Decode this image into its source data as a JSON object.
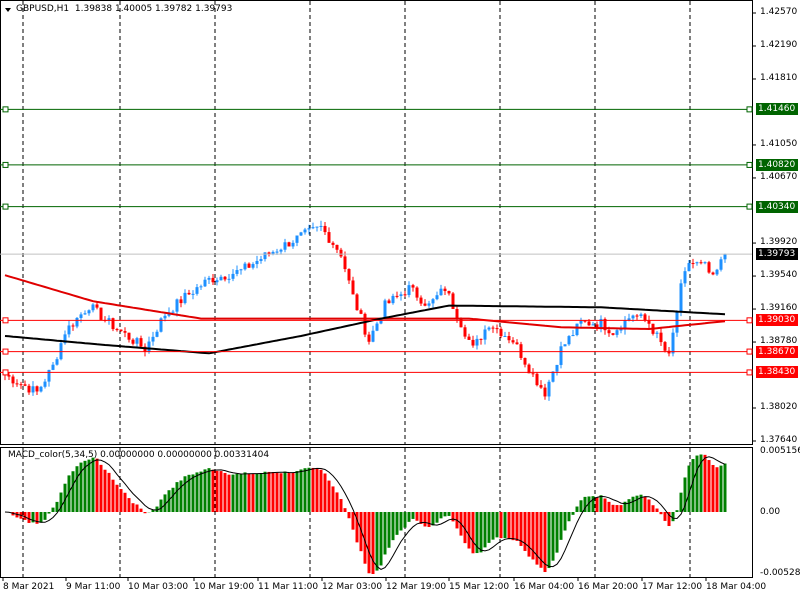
{
  "header": {
    "symbol": "GBPUSD,H1",
    "open": "1.39838",
    "high": "1.40005",
    "low": "1.39782",
    "close": "1.39793"
  },
  "price_axis": [
    "1.42570",
    "1.42190",
    "1.41810",
    "1.41050",
    "1.40670",
    "1.39920",
    "1.39540",
    "1.39160",
    "1.38780",
    "1.38020",
    "1.37640"
  ],
  "levels": [
    {
      "price": "1.41460",
      "color": "#006400"
    },
    {
      "price": "1.40820",
      "color": "#006400"
    },
    {
      "price": "1.40340",
      "color": "#006400"
    },
    {
      "price": "1.39030",
      "color": "#ff0000"
    },
    {
      "price": "1.38670",
      "color": "#ff0000"
    },
    {
      "price": "1.38430",
      "color": "#ff0000"
    }
  ],
  "current_price": "1.39793",
  "macd": {
    "label": "MACD_color(5,34,5) 0.00000000 0.00000000 0.00331404",
    "max": "0.0051569",
    "zero": "0.00",
    "min": "-0.005284"
  },
  "time_axis": [
    "8 Mar 2021",
    "9 Mar 11:00",
    "10 Mar 03:00",
    "10 Mar 19:00",
    "11 Mar 11:00",
    "12 Mar 03:00",
    "12 Mar 19:00",
    "15 Mar 12:00",
    "16 Mar 04:00",
    "16 Mar 20:00",
    "17 Mar 12:00",
    "18 Mar 04:00"
  ],
  "chart_data": {
    "type": "candlestick",
    "price_anchors": [
      [
        0,
        1.384
      ],
      [
        8,
        1.382
      ],
      [
        12,
        1.385
      ],
      [
        15,
        1.389
      ],
      [
        21,
        1.392
      ],
      [
        26,
        1.39
      ],
      [
        35,
        1.387
      ],
      [
        40,
        1.391
      ],
      [
        45,
        1.393
      ],
      [
        51,
        1.395
      ],
      [
        59,
        1.396
      ],
      [
        66,
        1.398
      ],
      [
        74,
        1.4
      ],
      [
        79,
        1.401
      ],
      [
        84,
        1.398
      ],
      [
        87,
        1.393
      ],
      [
        91,
        1.388
      ],
      [
        95,
        1.392
      ],
      [
        101,
        1.394
      ],
      [
        106,
        1.392
      ],
      [
        110,
        1.394
      ],
      [
        114,
        1.39
      ],
      [
        117,
        1.387
      ],
      [
        121,
        1.39
      ],
      [
        127,
        1.388
      ],
      [
        132,
        1.384
      ],
      [
        135,
        1.382
      ],
      [
        139,
        1.387
      ],
      [
        144,
        1.39
      ],
      [
        149,
        1.39
      ],
      [
        152,
        1.389
      ],
      [
        157,
        1.391
      ],
      [
        161,
        1.39
      ],
      [
        166,
        1.386
      ],
      [
        169,
        1.394
      ],
      [
        171,
        1.397
      ],
      [
        175,
        1.3965
      ],
      [
        177,
        1.395
      ],
      [
        180,
        1.3979
      ]
    ],
    "ma_red": [
      [
        0,
        1.3955
      ],
      [
        22,
        1.3925
      ],
      [
        49,
        1.3905
      ],
      [
        86,
        1.3905
      ],
      [
        116,
        1.3905
      ],
      [
        139,
        1.3895
      ],
      [
        161,
        1.3893
      ],
      [
        180,
        1.3902
      ]
    ],
    "ma_black": [
      [
        0,
        1.3885
      ],
      [
        24,
        1.3875
      ],
      [
        51,
        1.3865
      ],
      [
        74,
        1.3885
      ],
      [
        94,
        1.3905
      ],
      [
        111,
        1.392
      ],
      [
        149,
        1.3918
      ],
      [
        180,
        1.391
      ]
    ],
    "ylim": [
      1.3764,
      1.4257
    ]
  }
}
